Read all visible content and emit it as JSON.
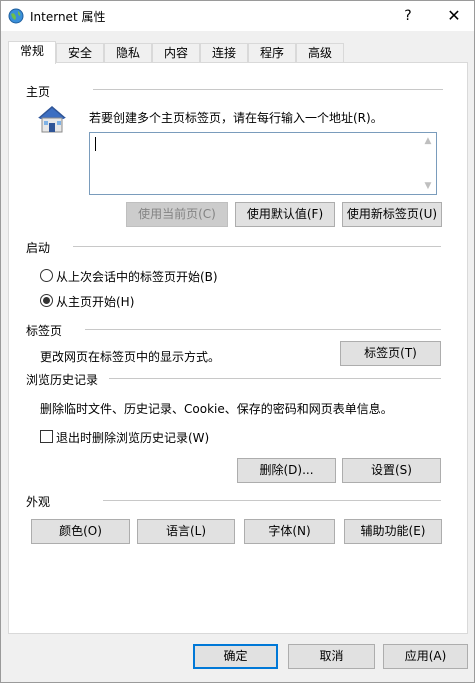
{
  "window": {
    "title": "Internet 属性",
    "help_label": "?",
    "close_label": "✕"
  },
  "tabs": [
    {
      "label": "常规",
      "active": true
    },
    {
      "label": "安全"
    },
    {
      "label": "隐私"
    },
    {
      "label": "内容"
    },
    {
      "label": "连接"
    },
    {
      "label": "程序"
    },
    {
      "label": "高级"
    }
  ],
  "homepage": {
    "section_label": "主页",
    "description": "若要创建多个主页标签页，请在每行输入一个地址(R)。",
    "value": "",
    "btn_current": "使用当前页(C)",
    "btn_default": "使用默认值(F)",
    "btn_newtab": "使用新标签页(U)"
  },
  "startup": {
    "section_label": "启动",
    "option_last_session": "从上次会话中的标签页开始(B)",
    "option_homepage": "从主页开始(H)",
    "selected": "homepage"
  },
  "tabs_section": {
    "section_label": "标签页",
    "description": "更改网页在标签页中的显示方式。",
    "btn_tabs": "标签页(T)"
  },
  "history": {
    "section_label": "浏览历史记录",
    "description": "删除临时文件、历史记录、Cookie、保存的密码和网页表单信息。",
    "checkbox_delete_on_exit": "退出时删除浏览历史记录(W)",
    "checked": false,
    "btn_delete": "删除(D)...",
    "btn_settings": "设置(S)"
  },
  "appearance": {
    "section_label": "外观",
    "btn_colors": "颜色(O)",
    "btn_languages": "语言(L)",
    "btn_fonts": "字体(N)",
    "btn_accessibility": "辅助功能(E)"
  },
  "footer": {
    "btn_ok": "确定",
    "btn_cancel": "取消",
    "btn_apply": "应用(A)"
  },
  "colors": {
    "accent": "#0078d7",
    "house_roof": "#2f5597",
    "house_wall": "#e8e8e8"
  }
}
